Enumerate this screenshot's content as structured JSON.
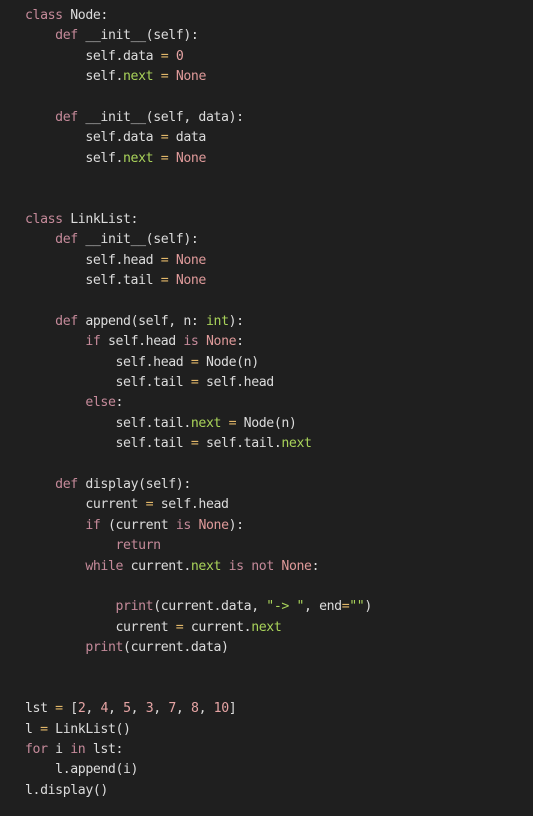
{
  "editor": {
    "theme": {
      "background": "#1f1f1f",
      "text": "#dcdcdc",
      "keyword": "#c58a9a",
      "none_literal": "#df9a9a",
      "attribute": "#a9d35a",
      "operator": "#e3b86a"
    },
    "lines": [
      [
        {
          "t": "class",
          "c": "kw"
        },
        {
          "t": " Node:"
        }
      ],
      [
        {
          "t": "    "
        },
        {
          "t": "def",
          "c": "kw"
        },
        {
          "t": " __init__(self):"
        }
      ],
      [
        {
          "t": "        self.data "
        },
        {
          "t": "=",
          "c": "op"
        },
        {
          "t": " "
        },
        {
          "t": "0",
          "c": "num"
        }
      ],
      [
        {
          "t": "        self."
        },
        {
          "t": "next",
          "c": "grn"
        },
        {
          "t": " "
        },
        {
          "t": "=",
          "c": "op"
        },
        {
          "t": " "
        },
        {
          "t": "None",
          "c": "none"
        }
      ],
      [],
      [
        {
          "t": "    "
        },
        {
          "t": "def",
          "c": "kw"
        },
        {
          "t": " __init__(self, data):"
        }
      ],
      [
        {
          "t": "        self.data "
        },
        {
          "t": "=",
          "c": "op"
        },
        {
          "t": " data"
        }
      ],
      [
        {
          "t": "        self."
        },
        {
          "t": "next",
          "c": "grn"
        },
        {
          "t": " "
        },
        {
          "t": "=",
          "c": "op"
        },
        {
          "t": " "
        },
        {
          "t": "None",
          "c": "none"
        }
      ],
      [],
      [],
      [
        {
          "t": "class",
          "c": "kw"
        },
        {
          "t": " LinkList:"
        }
      ],
      [
        {
          "t": "    "
        },
        {
          "t": "def",
          "c": "kw"
        },
        {
          "t": " __init__(self):"
        }
      ],
      [
        {
          "t": "        self.head "
        },
        {
          "t": "=",
          "c": "op"
        },
        {
          "t": " "
        },
        {
          "t": "None",
          "c": "none"
        }
      ],
      [
        {
          "t": "        self.tail "
        },
        {
          "t": "=",
          "c": "op"
        },
        {
          "t": " "
        },
        {
          "t": "None",
          "c": "none"
        }
      ],
      [],
      [
        {
          "t": "    "
        },
        {
          "t": "def",
          "c": "kw"
        },
        {
          "t": " append(self, n: "
        },
        {
          "t": "int",
          "c": "grn"
        },
        {
          "t": "):"
        }
      ],
      [
        {
          "t": "        "
        },
        {
          "t": "if",
          "c": "kw"
        },
        {
          "t": " self.head "
        },
        {
          "t": "is",
          "c": "kw"
        },
        {
          "t": " "
        },
        {
          "t": "None",
          "c": "none"
        },
        {
          "t": ":"
        }
      ],
      [
        {
          "t": "            self.head "
        },
        {
          "t": "=",
          "c": "op"
        },
        {
          "t": " Node(n)"
        }
      ],
      [
        {
          "t": "            self.tail "
        },
        {
          "t": "=",
          "c": "op"
        },
        {
          "t": " self.head"
        }
      ],
      [
        {
          "t": "        "
        },
        {
          "t": "else",
          "c": "kw"
        },
        {
          "t": ":"
        }
      ],
      [
        {
          "t": "            self.tail."
        },
        {
          "t": "next",
          "c": "grn"
        },
        {
          "t": " "
        },
        {
          "t": "=",
          "c": "op"
        },
        {
          "t": " Node(n)"
        }
      ],
      [
        {
          "t": "            self.tail "
        },
        {
          "t": "=",
          "c": "op"
        },
        {
          "t": " self.tail."
        },
        {
          "t": "next",
          "c": "grn"
        }
      ],
      [],
      [
        {
          "t": "    "
        },
        {
          "t": "def",
          "c": "kw"
        },
        {
          "t": " display(self):"
        }
      ],
      [
        {
          "t": "        current "
        },
        {
          "t": "=",
          "c": "op"
        },
        {
          "t": " self.head"
        }
      ],
      [
        {
          "t": "        "
        },
        {
          "t": "if",
          "c": "kw"
        },
        {
          "t": " (current "
        },
        {
          "t": "is",
          "c": "kw"
        },
        {
          "t": " "
        },
        {
          "t": "None",
          "c": "none"
        },
        {
          "t": "):"
        }
      ],
      [
        {
          "t": "            "
        },
        {
          "t": "return",
          "c": "kw"
        }
      ],
      [
        {
          "t": "        "
        },
        {
          "t": "while",
          "c": "kw"
        },
        {
          "t": " current."
        },
        {
          "t": "next",
          "c": "grn"
        },
        {
          "t": " "
        },
        {
          "t": "is",
          "c": "kw"
        },
        {
          "t": " "
        },
        {
          "t": "not",
          "c": "kw"
        },
        {
          "t": " "
        },
        {
          "t": "None",
          "c": "none"
        },
        {
          "t": ":"
        }
      ],
      [],
      [
        {
          "t": "            "
        },
        {
          "t": "print",
          "c": "kw"
        },
        {
          "t": "(current.data, "
        },
        {
          "t": "\"-> \"",
          "c": "str"
        },
        {
          "t": ", end"
        },
        {
          "t": "=",
          "c": "op"
        },
        {
          "t": "\"\"",
          "c": "str"
        },
        {
          "t": ")"
        }
      ],
      [
        {
          "t": "            current "
        },
        {
          "t": "=",
          "c": "op"
        },
        {
          "t": " current."
        },
        {
          "t": "next",
          "c": "grn"
        }
      ],
      [
        {
          "t": "        "
        },
        {
          "t": "print",
          "c": "kw"
        },
        {
          "t": "(current.data)"
        }
      ],
      [],
      [],
      [
        {
          "t": "lst "
        },
        {
          "t": "=",
          "c": "op"
        },
        {
          "t": " ["
        },
        {
          "t": "2",
          "c": "num"
        },
        {
          "t": ", "
        },
        {
          "t": "4",
          "c": "num"
        },
        {
          "t": ", "
        },
        {
          "t": "5",
          "c": "num"
        },
        {
          "t": ", "
        },
        {
          "t": "3",
          "c": "num"
        },
        {
          "t": ", "
        },
        {
          "t": "7",
          "c": "num"
        },
        {
          "t": ", "
        },
        {
          "t": "8",
          "c": "num"
        },
        {
          "t": ", "
        },
        {
          "t": "10",
          "c": "num"
        },
        {
          "t": "]"
        }
      ],
      [
        {
          "t": "l "
        },
        {
          "t": "=",
          "c": "op"
        },
        {
          "t": " LinkList()"
        }
      ],
      [
        {
          "t": "for",
          "c": "kw"
        },
        {
          "t": " i "
        },
        {
          "t": "in",
          "c": "kw"
        },
        {
          "t": " lst:"
        }
      ],
      [
        {
          "t": "    l.append(i)"
        }
      ],
      [
        {
          "t": "l.display()"
        }
      ]
    ]
  }
}
